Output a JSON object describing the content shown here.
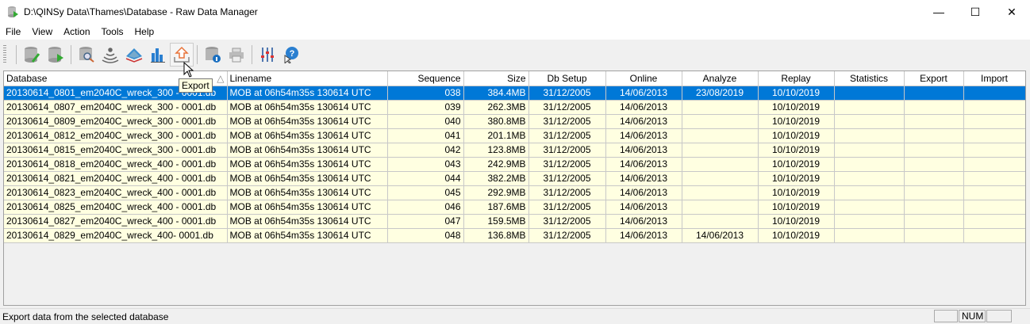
{
  "window": {
    "title": "D:\\QINSy Data\\Thames\\Database - Raw Data Manager"
  },
  "menu": [
    "File",
    "View",
    "Action",
    "Tools",
    "Help"
  ],
  "toolbar": {
    "icons": [
      "edit-database-icon",
      "run-database-icon",
      "inspect-database-icon",
      "sonar-icon",
      "surface-icon",
      "statistics-icon",
      "export-icon",
      "database-info-icon",
      "print-icon",
      "settings-icon",
      "help-icon"
    ],
    "tooltip": "Export"
  },
  "table": {
    "columns": [
      "Database",
      "Linename",
      "Sequence",
      "Size",
      "Db Setup",
      "Online",
      "Analyze",
      "Replay",
      "Statistics",
      "Export",
      "Import"
    ],
    "rows": [
      [
        "20130614_0801_em2040C_wreck_300 - 0001.db",
        "MOB at 06h54m35s 130614 UTC",
        "038",
        "384.4MB",
        "31/12/2005",
        "14/06/2013",
        "23/08/2019",
        "10/10/2019",
        "",
        "",
        ""
      ],
      [
        "20130614_0807_em2040C_wreck_300 - 0001.db",
        "MOB at 06h54m35s 130614 UTC",
        "039",
        "262.3MB",
        "31/12/2005",
        "14/06/2013",
        "",
        "10/10/2019",
        "",
        "",
        ""
      ],
      [
        "20130614_0809_em2040C_wreck_300 - 0001.db",
        "MOB at 06h54m35s 130614 UTC",
        "040",
        "380.8MB",
        "31/12/2005",
        "14/06/2013",
        "",
        "10/10/2019",
        "",
        "",
        ""
      ],
      [
        "20130614_0812_em2040C_wreck_300 - 0001.db",
        "MOB at 06h54m35s 130614 UTC",
        "041",
        "201.1MB",
        "31/12/2005",
        "14/06/2013",
        "",
        "10/10/2019",
        "",
        "",
        ""
      ],
      [
        "20130614_0815_em2040C_wreck_300 - 0001.db",
        "MOB at 06h54m35s 130614 UTC",
        "042",
        "123.8MB",
        "31/12/2005",
        "14/06/2013",
        "",
        "10/10/2019",
        "",
        "",
        ""
      ],
      [
        "20130614_0818_em2040C_wreck_400 - 0001.db",
        "MOB at 06h54m35s 130614 UTC",
        "043",
        "242.9MB",
        "31/12/2005",
        "14/06/2013",
        "",
        "10/10/2019",
        "",
        "",
        ""
      ],
      [
        "20130614_0821_em2040C_wreck_400 - 0001.db",
        "MOB at 06h54m35s 130614 UTC",
        "044",
        "382.2MB",
        "31/12/2005",
        "14/06/2013",
        "",
        "10/10/2019",
        "",
        "",
        ""
      ],
      [
        "20130614_0823_em2040C_wreck_400 - 0001.db",
        "MOB at 06h54m35s 130614 UTC",
        "045",
        "292.9MB",
        "31/12/2005",
        "14/06/2013",
        "",
        "10/10/2019",
        "",
        "",
        ""
      ],
      [
        "20130614_0825_em2040C_wreck_400 - 0001.db",
        "MOB at 06h54m35s 130614 UTC",
        "046",
        "187.6MB",
        "31/12/2005",
        "14/06/2013",
        "",
        "10/10/2019",
        "",
        "",
        ""
      ],
      [
        "20130614_0827_em2040C_wreck_400 - 0001.db",
        "MOB at 06h54m35s 130614 UTC",
        "047",
        "159.5MB",
        "31/12/2005",
        "14/06/2013",
        "",
        "10/10/2019",
        "",
        "",
        ""
      ],
      [
        "20130614_0829_em2040C_wreck_400- 0001.db",
        "MOB at 06h54m35s 130614 UTC",
        "048",
        "136.8MB",
        "31/12/2005",
        "14/06/2013",
        "14/06/2013",
        "10/10/2019",
        "",
        "",
        ""
      ]
    ],
    "selected_row": 0,
    "sort_column": "Database"
  },
  "status": {
    "text": "Export data from the selected database",
    "num": "NUM"
  },
  "colors": {
    "selection": "#0078d7",
    "row_bg": "#ffffe1"
  }
}
